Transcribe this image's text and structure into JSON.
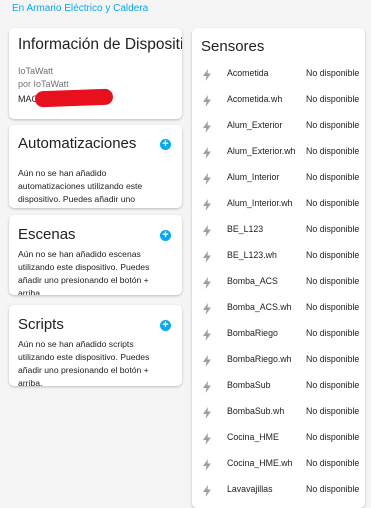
{
  "breadcrumb": "En Armario Eléctrico y Caldera",
  "device": {
    "title": "Información de Dispositivo",
    "model": "IoTaWatt",
    "manufacturer": "por IoTaWatt",
    "mac_label": "MAC"
  },
  "automations": {
    "title": "Automatizaciones",
    "text": "Aún no se han añadido automatizaciones utilizando este dispositivo. Puedes añadir uno presionando el botón + arriba."
  },
  "scenes": {
    "title": "Escenas",
    "text": "Aún no se han añadido escenas utilizando este dispositivo. Puedes añadir uno presionando el botón + arriba."
  },
  "scripts": {
    "title": "Scripts",
    "text": "Aún no se han añadido scripts utilizando este dispositivo. Puedes añadir uno presionando el botón + arriba."
  },
  "sensors": {
    "title": "Sensores",
    "items": [
      {
        "name": "Acometida",
        "state": "No disponible"
      },
      {
        "name": "Acometida.wh",
        "state": "No disponible"
      },
      {
        "name": "Alum_Exterior",
        "state": "No disponible"
      },
      {
        "name": "Alum_Exterior.wh",
        "state": "No disponible"
      },
      {
        "name": "Alum_Interior",
        "state": "No disponible"
      },
      {
        "name": "Alum_Interior.wh",
        "state": "No disponible"
      },
      {
        "name": "BE_L123",
        "state": "No disponible"
      },
      {
        "name": "BE_L123.wh",
        "state": "No disponible"
      },
      {
        "name": "Bomba_ACS",
        "state": "No disponible"
      },
      {
        "name": "Bomba_ACS.wh",
        "state": "No disponible"
      },
      {
        "name": "BombaRiego",
        "state": "No disponible"
      },
      {
        "name": "BombaRiego.wh",
        "state": "No disponible"
      },
      {
        "name": "BombaSub",
        "state": "No disponible"
      },
      {
        "name": "BombaSub.wh",
        "state": "No disponible"
      },
      {
        "name": "Cocina_HME",
        "state": "No disponible"
      },
      {
        "name": "Cocina_HME.wh",
        "state": "No disponible"
      },
      {
        "name": "Lavavajillas",
        "state": "No disponible"
      }
    ]
  },
  "colors": {
    "accent": "#03a9f4",
    "icon": "#9e9e9e",
    "redaction": "#e8101c"
  },
  "icons": {
    "add": "plus-circle-icon",
    "sensor": "flash-icon"
  }
}
